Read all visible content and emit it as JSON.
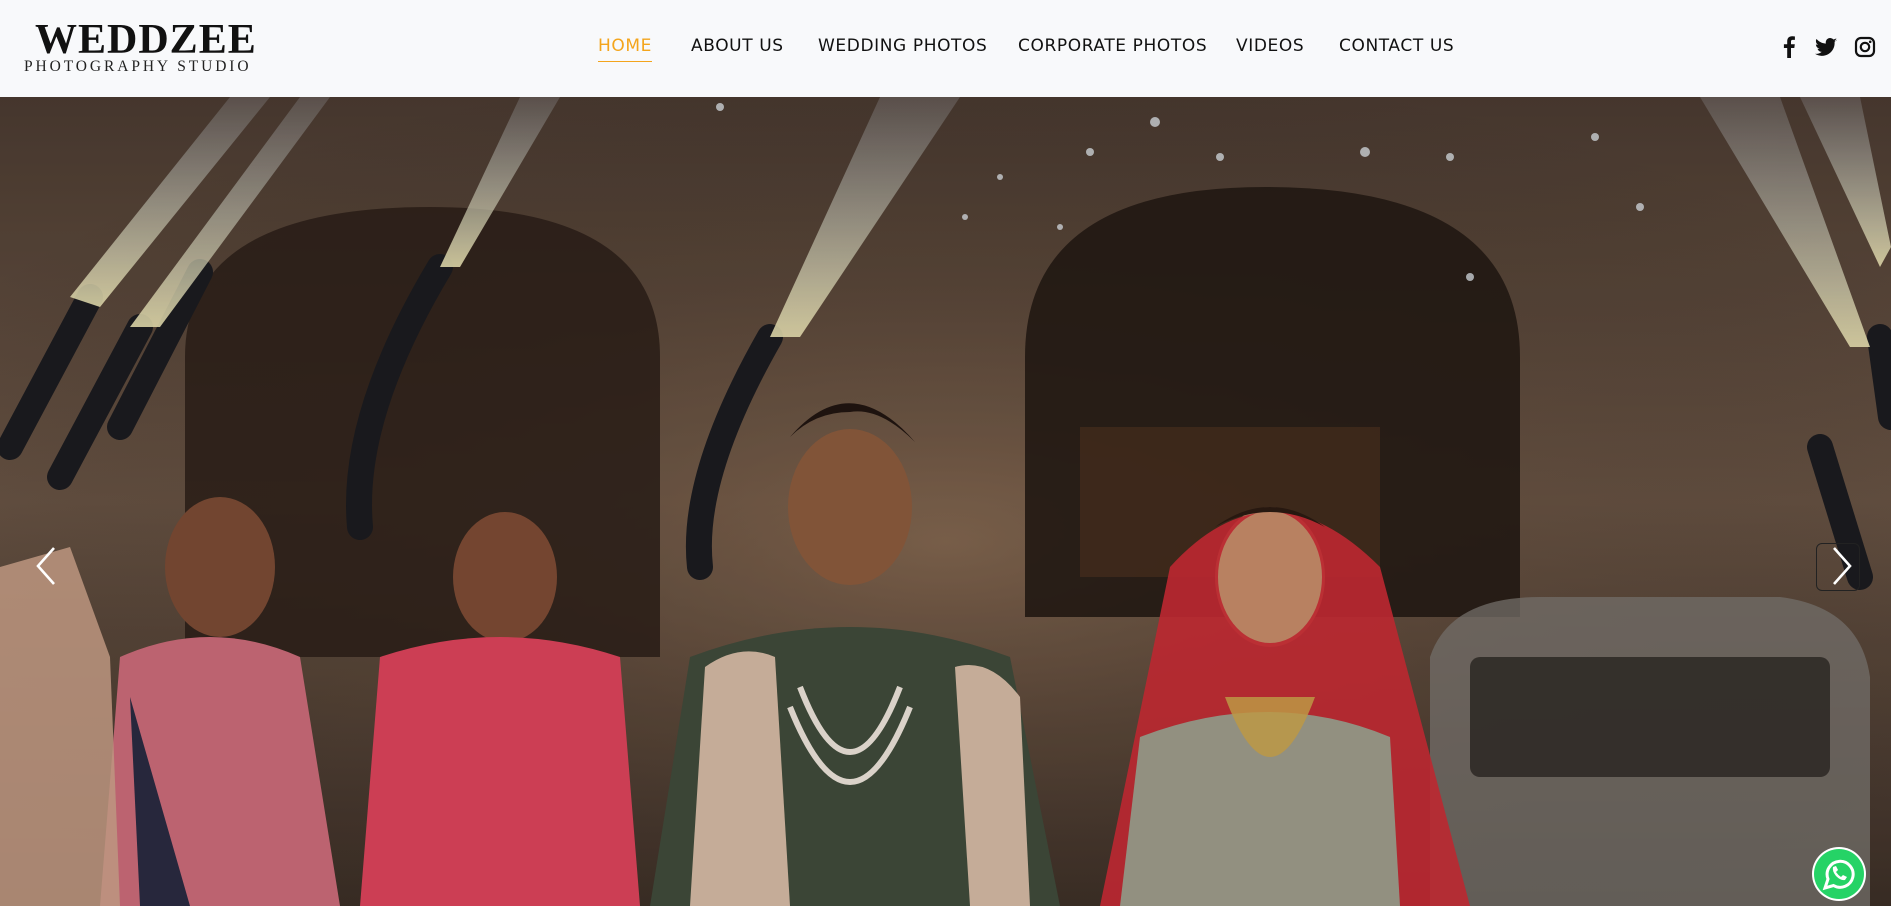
{
  "brand": {
    "name": "WEDDZEE",
    "tagline": "PHOTOGRAPHY STUDIO"
  },
  "nav": {
    "items": [
      {
        "label": "HOME",
        "active": true
      },
      {
        "label": "ABOUT US",
        "active": false
      },
      {
        "label": "WEDDING PHOTOS",
        "active": false
      },
      {
        "label": "CORPORATE PHOTOS",
        "active": false
      },
      {
        "label": "VIDEOS",
        "active": false
      },
      {
        "label": "CONTACT US",
        "active": false
      }
    ]
  },
  "social": [
    "facebook-icon",
    "twitter-icon",
    "instagram-icon"
  ],
  "hero": {
    "controls": [
      "arrow-left-icon",
      "arrow-right-icon"
    ],
    "whatsapp_icon": "whatsapp-icon"
  },
  "colors": {
    "accent": "#f4a51c",
    "text": "#111111",
    "header_bg": "#f8f9fb",
    "whatsapp": "#25d366"
  }
}
